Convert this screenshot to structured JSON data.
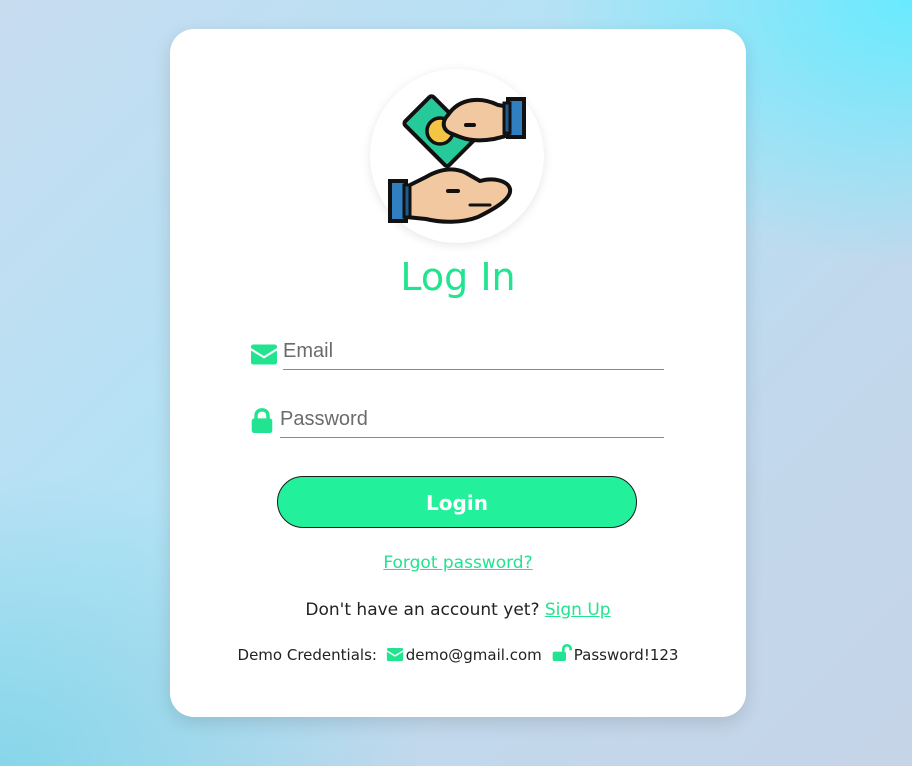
{
  "login": {
    "title": "Log In",
    "email": {
      "placeholder": "Email",
      "icon": "envelope-icon"
    },
    "password": {
      "placeholder": "Password",
      "icon": "lock-icon"
    },
    "submit_label": "Login",
    "forgot_label": "Forgot password?",
    "signup_prompt": "Don't have an account yet?",
    "signup_label": "Sign Up",
    "demo": {
      "label": "Demo Credentials:",
      "email": "demo@gmail.com",
      "password": "Password!123"
    }
  },
  "logo": {
    "icon": "hands-money-exchange-icon"
  },
  "colors": {
    "accent": "#22e38f",
    "button_bg": "#22f09a",
    "card_bg": "#ffffff"
  }
}
